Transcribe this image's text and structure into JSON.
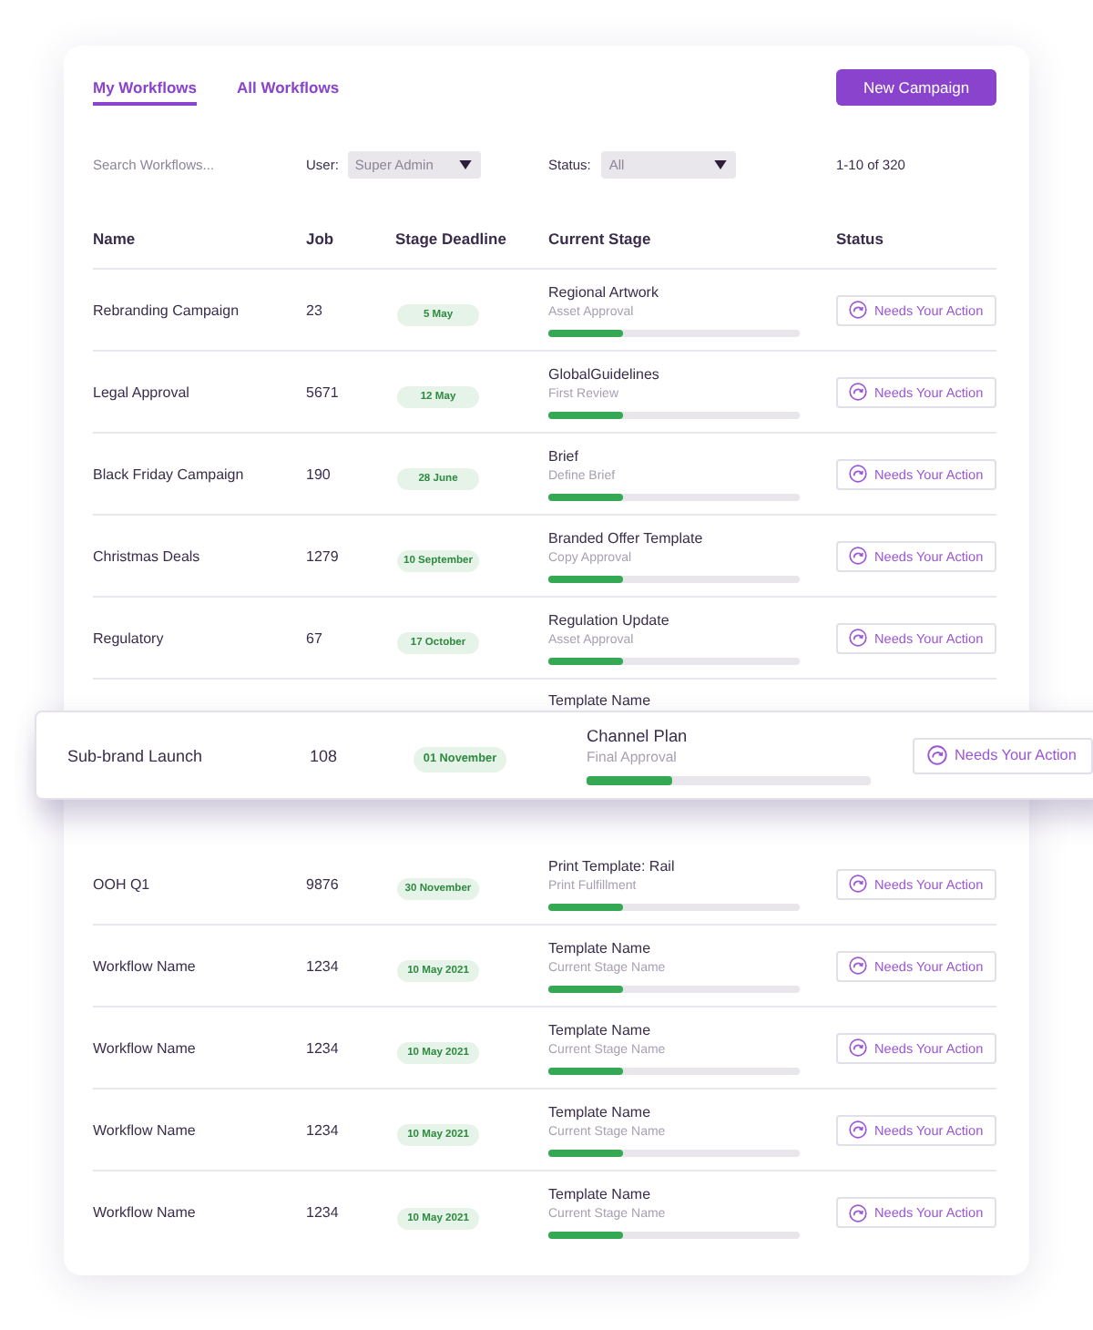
{
  "tabs": [
    {
      "label": "My Workflows",
      "selected": true
    },
    {
      "label": "All Workflows",
      "selected": false
    }
  ],
  "new_button": {
    "label": "New Campaign"
  },
  "filters": {
    "search": {
      "placeholder": "Search Workflows..."
    },
    "user": {
      "label": "User:",
      "value": "Super Admin"
    },
    "status": {
      "label": "Status:",
      "value": "All"
    },
    "pagination": "1-10 of 320"
  },
  "table": {
    "columns": [
      "Name",
      "Job",
      "Stage Deadline",
      "Current Stage",
      "Status"
    ],
    "rows": [
      {
        "kind": "row",
        "name": "Rebranding Campaign",
        "job": "23",
        "deadline": "5 May",
        "stage": "Regional Artwork",
        "substage": "Asset Approval",
        "level": 0.3,
        "status": "Needs Your Action"
      },
      {
        "kind": "row",
        "name": "Legal Approval",
        "job": "5671",
        "deadline": "12 May",
        "stage": "GlobalGuidelines",
        "substage": "First Review",
        "level": 0.3,
        "status": "Needs Your Action"
      },
      {
        "kind": "row",
        "name": "Black Friday Campaign",
        "job": "190",
        "deadline": "28 June",
        "stage": "Brief",
        "substage": "Define Brief",
        "level": 0.3,
        "status": "Needs Your Action"
      },
      {
        "kind": "row",
        "name": "Christmas Deals",
        "job": "1279",
        "deadline": "10 September",
        "stage": "Branded Offer Template",
        "substage": "Copy Approval",
        "level": 0.3,
        "status": "Needs Your Action"
      },
      {
        "kind": "row",
        "name": "Regulatory",
        "job": "67",
        "deadline": "17 October",
        "stage": "Regulation Update",
        "substage": "Asset Approval",
        "level": 0.3,
        "status": "Needs Your Action"
      },
      {
        "kind": "covered",
        "stage": "Template Name"
      },
      {
        "kind": "row",
        "name": "OOH Q1",
        "job": "9876",
        "deadline": "30 November",
        "stage": "Print Template: Rail",
        "substage": "Print Fulfillment",
        "level": 0.3,
        "status": "Needs Your Action"
      },
      {
        "kind": "row",
        "name": "Workflow Name",
        "job": "1234",
        "deadline": "10 May 2021",
        "stage": "Template Name",
        "substage": "Current Stage Name",
        "level": 0.3,
        "status": "Needs Your Action"
      },
      {
        "kind": "row",
        "name": "Workflow Name",
        "job": "1234",
        "deadline": "10 May 2021",
        "stage": "Template Name",
        "substage": "Current Stage Name",
        "level": 0.3,
        "status": "Needs Your Action"
      },
      {
        "kind": "row",
        "name": "Workflow Name",
        "job": "1234",
        "deadline": "10 May 2021",
        "stage": "Template Name",
        "substage": "Current Stage Name",
        "level": 0.3,
        "status": "Needs Your Action"
      },
      {
        "kind": "row",
        "name": "Workflow Name",
        "job": "1234",
        "deadline": "10 May 2021",
        "stage": "Template Name",
        "substage": "Current Stage Name",
        "level": 0.3,
        "status": "Needs Your Action"
      }
    ],
    "floating_row": {
      "name": "Sub-brand Launch",
      "job": "108",
      "deadline": "01 November",
      "stage": "Channel Plan",
      "substage": "Final Approval",
      "level": 0.3,
      "status": "Needs Your Action"
    }
  }
}
